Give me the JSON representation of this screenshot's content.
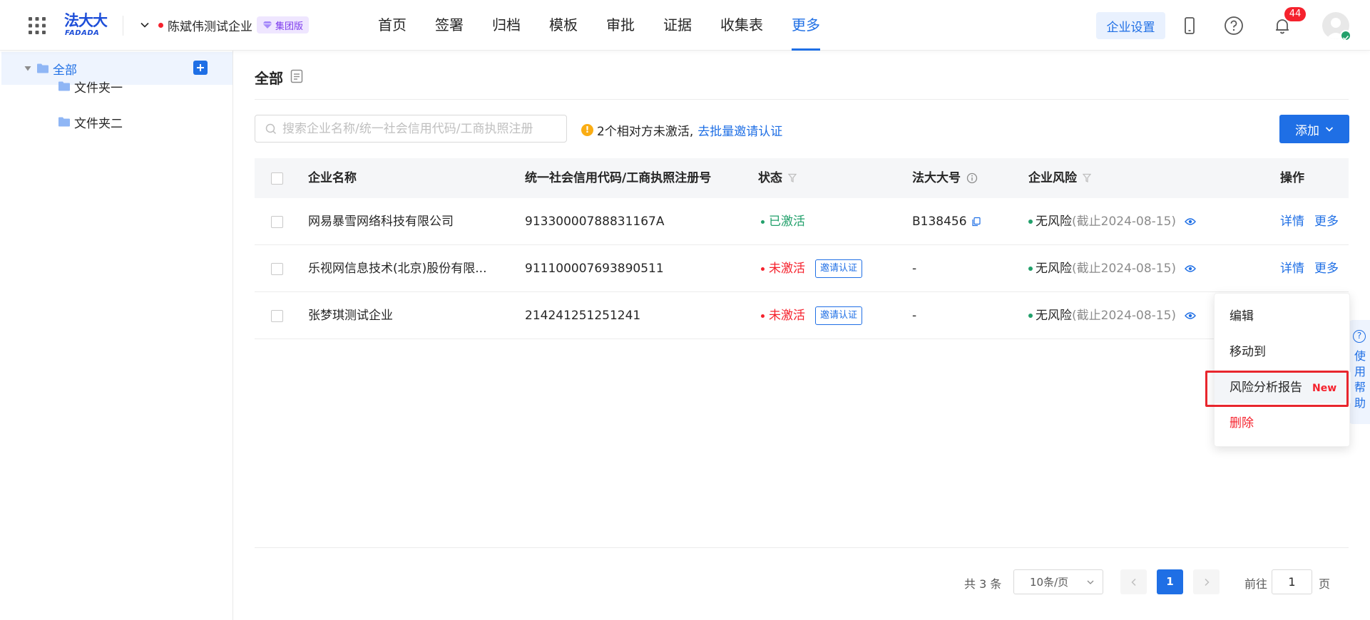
{
  "header": {
    "logo_cn": "法大大",
    "logo_en": "FADADA",
    "company_name": "陈斌伟测试企业",
    "edition_badge": "集团版",
    "nav": [
      "首页",
      "签署",
      "归档",
      "模板",
      "审批",
      "证据",
      "收集表",
      "更多"
    ],
    "active_nav": "更多",
    "settings_label": "企业设置",
    "notification_count": "44"
  },
  "sidebar": {
    "root_label": "全部",
    "folders": [
      "文件夹一",
      "文件夹二"
    ]
  },
  "main": {
    "title": "全部",
    "search_placeholder": "搜索企业名称/统一社会信用代码/工商执照注册",
    "warning_text": "2个相对方未激活,",
    "warning_link": "去批量邀请认证",
    "add_label": "添加"
  },
  "table": {
    "columns": {
      "name": "企业名称",
      "code": "统一社会信用代码/工商执照注册号",
      "status": "状态",
      "fdd_id": "法大大号",
      "risk": "企业风险",
      "ops": "操作"
    },
    "rows": [
      {
        "name": "网易暴雪网络科技有限公司",
        "code": "91330000788831167A",
        "status": "已激活",
        "invite": "",
        "fdd_id": "B138456",
        "risk": "无风险",
        "deadline": "(截止2024-08-15)",
        "detail": "详情",
        "more": "更多"
      },
      {
        "name": "乐视网信息技术(北京)股份有限...",
        "code": "911100007693890511",
        "status": "未激活",
        "invite": "邀请认证",
        "fdd_id": "-",
        "risk": "无风险",
        "deadline": "(截止2024-08-15)",
        "detail": "详情",
        "more": "更多"
      },
      {
        "name": "张梦琪测试企业",
        "code": "214241251251241",
        "status": "未激活",
        "invite": "邀请认证",
        "fdd_id": "-",
        "risk": "无风险",
        "deadline": "(截止2024-08-15)",
        "detail": "",
        "more": ""
      }
    ]
  },
  "dropdown": {
    "edit": "编辑",
    "move": "移动到",
    "risk_report": "风险分析报告",
    "new_tag": "New",
    "delete": "删除"
  },
  "help": {
    "label": "使用帮助"
  },
  "pagination": {
    "total": "共 3 条",
    "page_size": "10条/页",
    "current_page": "1",
    "goto_label": "前往",
    "goto_value": "1",
    "page_suffix": "页"
  },
  "colors": {
    "accent": "#1f6fe5",
    "active_green": "#22a06b",
    "inactive_red": "#f5222d",
    "highlight_red": "#e8262d"
  }
}
